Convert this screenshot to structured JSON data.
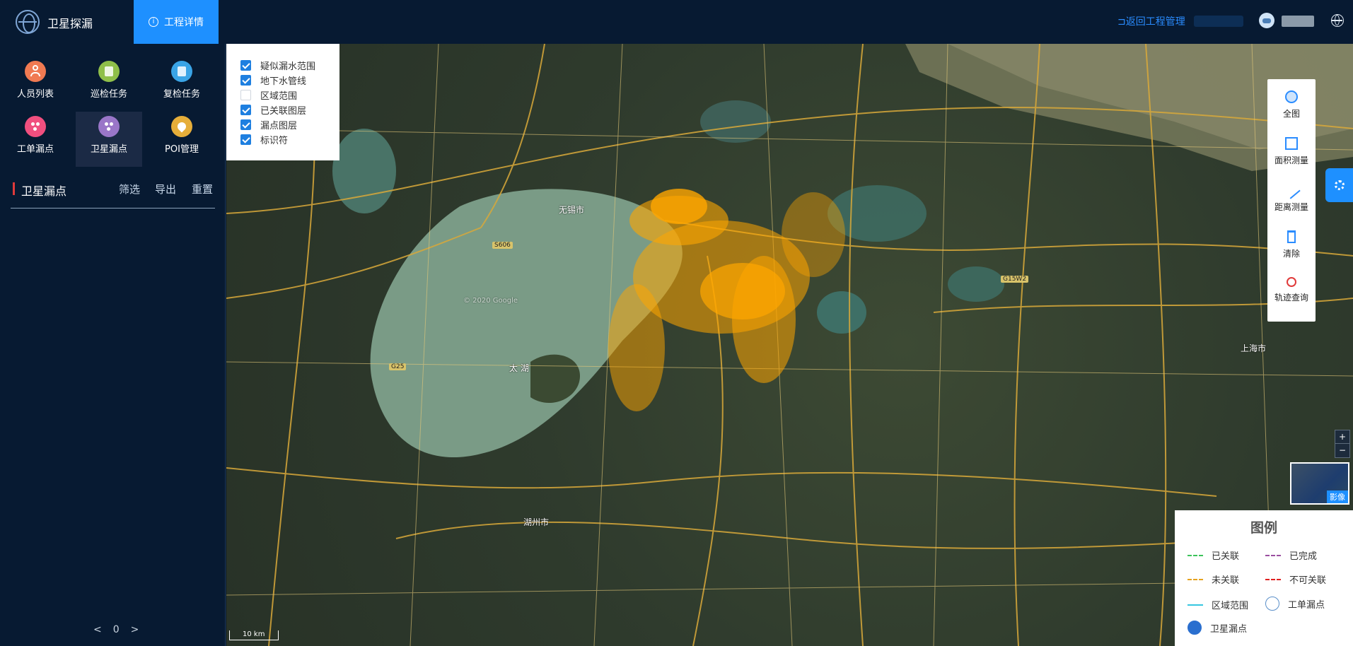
{
  "header": {
    "app_title": "卫星探漏",
    "active_tab": "工程详情",
    "back_link": "⊐返回工程管理"
  },
  "sidebar": {
    "menu": [
      {
        "label": "人员列表",
        "icon": "people-icon",
        "color": "#f07a52"
      },
      {
        "label": "巡检任务",
        "icon": "clipboard-icon",
        "color": "#8fbf4a"
      },
      {
        "label": "复检任务",
        "icon": "clipboard-check-icon",
        "color": "#3aa4e6"
      },
      {
        "label": "工单漏点",
        "icon": "dots-icon",
        "color": "#f04f7f"
      },
      {
        "label": "卫星漏点",
        "icon": "satellite-dots-icon",
        "color": "#9a76c8",
        "active": true
      },
      {
        "label": "POI管理",
        "icon": "location-pin-icon",
        "color": "#e6ae3a"
      }
    ],
    "section_title": "卫星漏点",
    "actions": {
      "filter": "筛选",
      "export": "导出",
      "reset": "重置"
    },
    "pager": {
      "prev": "<",
      "page": "0",
      "next": ">"
    }
  },
  "layers": [
    {
      "label": "疑似漏水范围",
      "checked": true
    },
    {
      "label": "地下水管线",
      "checked": true
    },
    {
      "label": "区域范围",
      "checked": false
    },
    {
      "label": "已关联图层",
      "checked": true
    },
    {
      "label": "漏点图层",
      "checked": true
    },
    {
      "label": "标识符",
      "checked": true
    }
  ],
  "tools": [
    {
      "label": "全图",
      "icon": "globe-icon"
    },
    {
      "label": "面积测量",
      "icon": "area-measure-icon"
    },
    {
      "label": "距离测量",
      "icon": "ruler-icon"
    },
    {
      "label": "清除",
      "icon": "trash-icon"
    },
    {
      "label": "轨迹查询",
      "icon": "track-pin-icon"
    }
  ],
  "zoom": {
    "in": "+",
    "out": "−"
  },
  "minimap_label": "影像",
  "legend": {
    "title": "图例",
    "items": [
      {
        "label": "已关联",
        "style": "dashed",
        "color": "#3cc35a"
      },
      {
        "label": "已完成",
        "style": "dashed",
        "color": "#9b4fa0"
      },
      {
        "label": "未关联",
        "style": "dashed",
        "color": "#e6a21e"
      },
      {
        "label": "不可关联",
        "style": "dashed",
        "color": "#e02020"
      },
      {
        "label": "区域范围",
        "style": "solid",
        "color": "#36c6e0"
      },
      {
        "label": "工单漏点",
        "style": "icon",
        "color": "#5a8fc9"
      },
      {
        "label": "卫星漏点",
        "style": "icon",
        "color": "#2a6fcf"
      }
    ]
  },
  "map_labels": {
    "lake": "太 湖",
    "wuxi": "无锡市",
    "shanghai": "上海市",
    "huzhou": "湖州市",
    "copyright": "© 2020 Google",
    "scale": "10 km"
  }
}
